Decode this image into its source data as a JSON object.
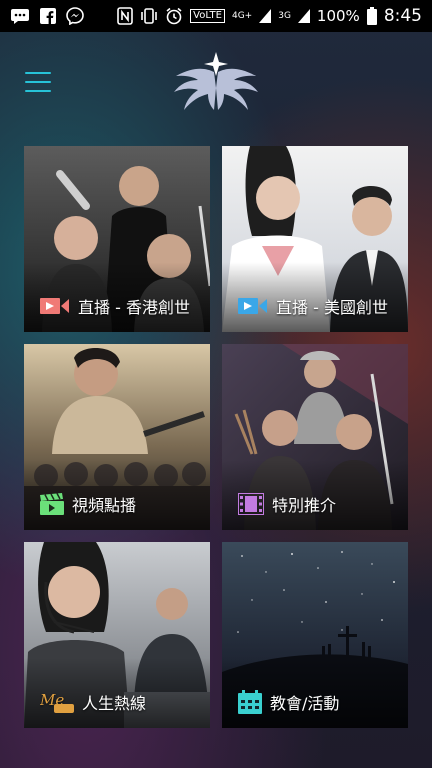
{
  "status_bar": {
    "network_labels": [
      "VoLTE",
      "4G+",
      "3G"
    ],
    "battery": "100%",
    "time": "8:45"
  },
  "header": {
    "menu_icon": "hamburger-menu-icon",
    "logo_icon": "winged-star-logo"
  },
  "tiles": [
    {
      "label": "直播 - 香港創世",
      "icon": "live-video-icon",
      "icon_color": "#f07a76"
    },
    {
      "label": "直播 - 美國創世",
      "icon": "live-video-icon",
      "icon_color": "#3aa7e8"
    },
    {
      "label": "視頻點播",
      "icon": "clapperboard-icon",
      "icon_color": "#6be07a"
    },
    {
      "label": "特別推介",
      "icon": "film-strip-icon",
      "icon_color": "#c27be0"
    },
    {
      "label": "人生熱線",
      "icon": "hotline-logo",
      "icon_color": "#e0a040"
    },
    {
      "label": "教會/活動",
      "icon": "calendar-icon",
      "icon_color": "#3ad0d0"
    }
  ]
}
